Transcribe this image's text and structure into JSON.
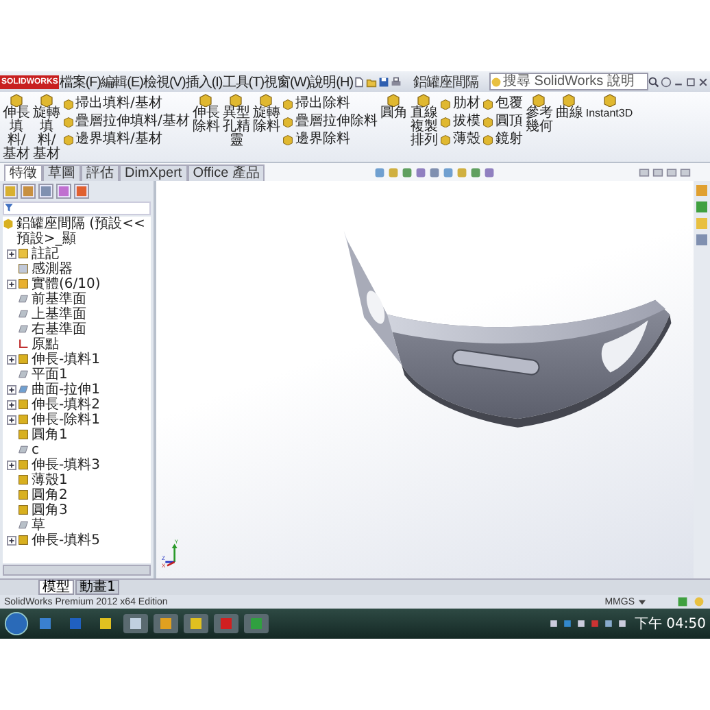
{
  "logo": "SOLIDWORKS",
  "menus": [
    "檔案(F)",
    "編輯(E)",
    "檢視(V)",
    "插入(I)",
    "工具(T)",
    "視窗(W)",
    "說明(H)"
  ],
  "document_title": "鋁罐座間隔",
  "search": {
    "placeholder": "搜尋 SolidWorks 說明"
  },
  "ribbon": [
    {
      "kind": "large",
      "label": "伸長填料/基材"
    },
    {
      "kind": "large",
      "label": "旋轉填料/基材"
    },
    {
      "kind": "stack",
      "items": [
        "掃出填料/基材",
        "疊層拉伸填料/基材",
        "邊界填料/基材"
      ]
    },
    {
      "kind": "large",
      "label": "伸長除料"
    },
    {
      "kind": "large",
      "label": "異型孔精靈"
    },
    {
      "kind": "large",
      "label": "旋轉除料"
    },
    {
      "kind": "stack",
      "items": [
        "掃出除料",
        "疊層拉伸除料",
        "邊界除料"
      ]
    },
    {
      "kind": "large",
      "label": "圓角"
    },
    {
      "kind": "large",
      "label": "直線複製排列"
    },
    {
      "kind": "stack",
      "items": [
        "肋材",
        "拔模",
        "薄殼"
      ]
    },
    {
      "kind": "stack",
      "items": [
        "包覆",
        "圓頂",
        "鏡射"
      ]
    },
    {
      "kind": "large",
      "label": "參考幾何"
    },
    {
      "kind": "large",
      "label": "曲線"
    },
    {
      "kind": "wide",
      "label": "Instant3D"
    }
  ],
  "command_tabs": [
    {
      "label": "特徵",
      "selected": true
    },
    {
      "label": "草圖",
      "selected": false
    },
    {
      "label": "評估",
      "selected": false
    },
    {
      "label": "DimXpert",
      "selected": false
    },
    {
      "label": "Office 產品",
      "selected": false
    }
  ],
  "feature_tree": {
    "root": "鋁罐座間隔 (預設<<預設>_顯",
    "children": [
      {
        "label": "註記",
        "kind": "annotation",
        "expanded": false
      },
      {
        "label": "感測器",
        "kind": "sensor"
      },
      {
        "label": "實體(6/10)",
        "kind": "bodies",
        "expanded": false
      },
      {
        "label": "前基準面",
        "kind": "plane"
      },
      {
        "label": "上基準面",
        "kind": "plane"
      },
      {
        "label": "右基準面",
        "kind": "plane"
      },
      {
        "label": "原點",
        "kind": "origin"
      },
      {
        "label": "伸長-填料1",
        "kind": "feature",
        "expanded": false
      },
      {
        "label": "平面1",
        "kind": "plane"
      },
      {
        "label": "曲面-拉伸1",
        "kind": "surface",
        "expanded": false
      },
      {
        "label": "伸長-填料2",
        "kind": "feature",
        "expanded": false
      },
      {
        "label": "伸長-除料1",
        "kind": "feature",
        "expanded": false
      },
      {
        "label": "圓角1",
        "kind": "feature"
      },
      {
        "label": "c",
        "kind": "plane"
      },
      {
        "label": "伸長-填料3",
        "kind": "feature",
        "expanded": false
      },
      {
        "label": "薄殼1",
        "kind": "feature"
      },
      {
        "label": "圓角2",
        "kind": "feature"
      },
      {
        "label": "圓角3",
        "kind": "feature"
      },
      {
        "label": "草",
        "kind": "plane"
      },
      {
        "label": "伸長-填料5",
        "kind": "feature",
        "expanded": false
      }
    ]
  },
  "triad": [
    "Y",
    "Z",
    "X"
  ],
  "bottom_tabs": [
    {
      "label": "模型",
      "selected": true
    },
    {
      "label": "動畫1",
      "selected": false
    }
  ],
  "status_bar": {
    "text": "SolidWorks Premium 2012 x64 Edition",
    "units": "MMGS"
  },
  "taskbar": {
    "clock": "下午 04:50"
  }
}
